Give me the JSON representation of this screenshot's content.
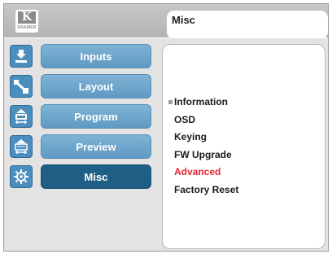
{
  "header": {
    "logo_text": "K",
    "logo_subtext": "KRAMER",
    "title": "Misc"
  },
  "sidebar": {
    "items": [
      {
        "label": "Inputs",
        "icon": "inputs-icon",
        "active": false
      },
      {
        "label": "Layout",
        "icon": "layout-icon",
        "active": false
      },
      {
        "label": "Program",
        "icon": "program-icon",
        "active": false
      },
      {
        "label": "Preview",
        "icon": "preview-icon",
        "active": false
      },
      {
        "label": "Misc",
        "icon": "misc-icon",
        "active": true
      }
    ]
  },
  "submenu": {
    "items": [
      {
        "label": "Information",
        "selected": true
      },
      {
        "label": "OSD",
        "selected": false
      },
      {
        "label": "Keying",
        "selected": false
      },
      {
        "label": "FW Upgrade",
        "selected": false
      },
      {
        "label": "Advanced",
        "selected": false,
        "highlight": true
      },
      {
        "label": "Factory Reset",
        "selected": false
      }
    ]
  },
  "colors": {
    "button": "#6ba4cb",
    "button_active": "#1f5f86",
    "icon_bg": "#4b8dbd",
    "highlight": "#e8262e",
    "panel_bg": "#e3e3e3"
  }
}
